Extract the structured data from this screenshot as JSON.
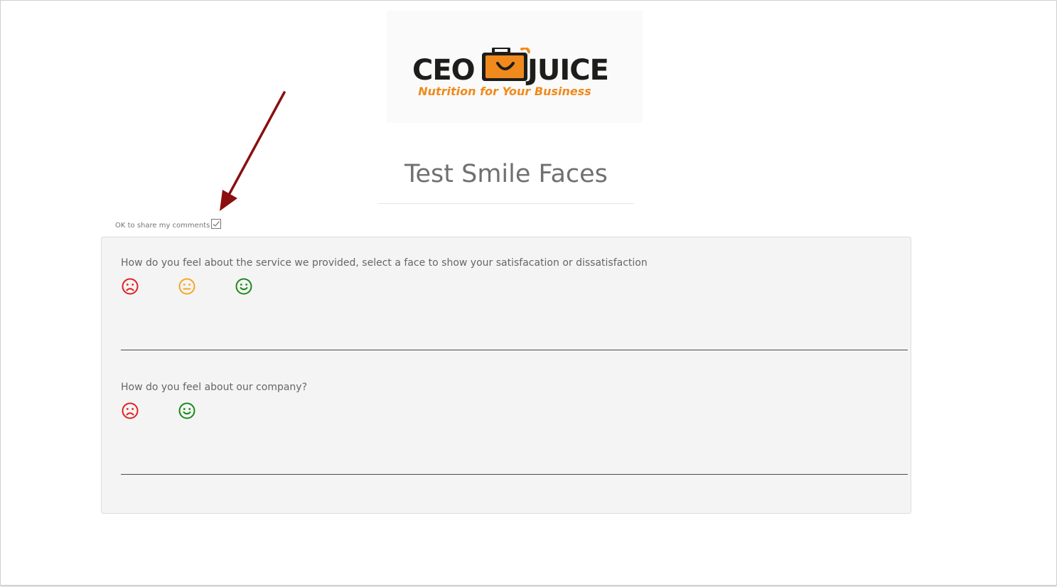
{
  "logo": {
    "word_left": "CEO",
    "word_right": "JUICE",
    "tagline": "Nutrition for Your Business",
    "brand_orange": "#f08a1c",
    "brand_dark": "#1d1d1b"
  },
  "page": {
    "title": "Test Smile Faces"
  },
  "share": {
    "label": "OK to share my comments",
    "checked": true
  },
  "questions": [
    {
      "text": "How do you feel about the service we provided, select a face to show your satisfacation or dissatisfaction",
      "faces": [
        {
          "icon": "frown-face-icon",
          "color": "#e02020"
        },
        {
          "icon": "neutral-face-icon",
          "color": "#f5a623"
        },
        {
          "icon": "smile-face-icon",
          "color": "#1a8a1a"
        }
      ]
    },
    {
      "text": "How do you feel about our company?",
      "faces": [
        {
          "icon": "frown-face-icon",
          "color": "#e02020"
        },
        {
          "icon": "smile-face-icon",
          "color": "#1a8a1a"
        }
      ]
    }
  ],
  "annotation": {
    "arrow_color": "#8b0f0f"
  }
}
